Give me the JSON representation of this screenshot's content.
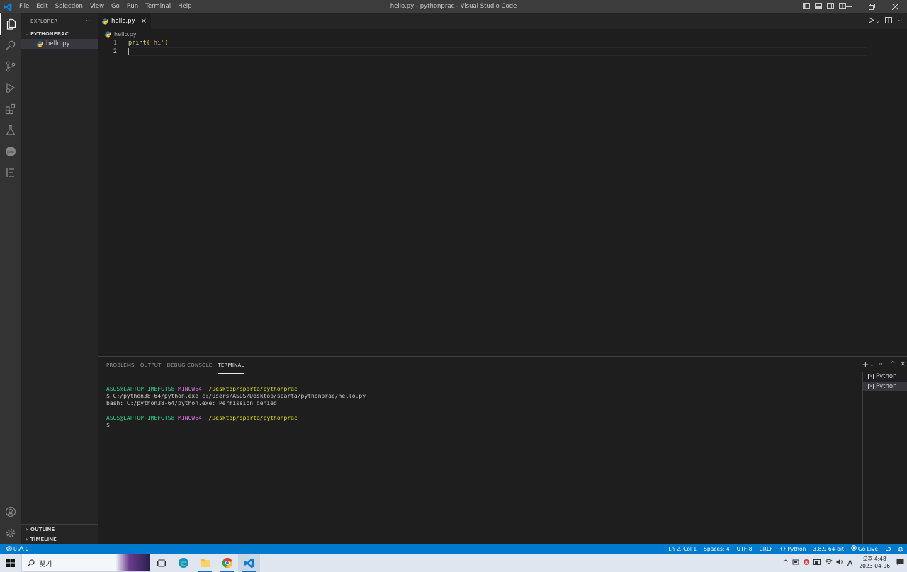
{
  "titlebar": {
    "title": "hello.py - pythonprac - Visual Studio Code",
    "menu": [
      "File",
      "Edit",
      "Selection",
      "View",
      "Go",
      "Run",
      "Terminal",
      "Help"
    ]
  },
  "sidebar": {
    "header": "EXPLORER",
    "more": "···",
    "folder": "PYTHONPRAC",
    "files": [
      "hello.py"
    ],
    "outline": "OUTLINE",
    "timeline": "TIMELINE"
  },
  "editor": {
    "tab_label": "hello.py",
    "breadcrumb": "hello.py",
    "lines": [
      {
        "number": "1",
        "fn": "print",
        "open": "(",
        "str": "'hi'",
        "close": ")"
      },
      {
        "number": "2"
      }
    ]
  },
  "panel": {
    "tabs": [
      "PROBLEMS",
      "OUTPUT",
      "DEBUG CONSOLE",
      "TERMINAL"
    ],
    "active_tab": "TERMINAL",
    "terminal": {
      "prompt_user": "ASUS@LAPTOP-1MEFGTS8",
      "prompt_shell": "MINGW64",
      "prompt_path": "~/Desktop/sparta/pythonprac",
      "command": "$ C:/python38-64/python.exe c:/Users/ASUS/Desktop/sparta/pythonprac/hello.py",
      "error": "bash: C:/python38-64/python.exe: Permission denied",
      "prompt2_user": "ASUS@LAPTOP-1MEFGTS8",
      "prompt2_shell": "MINGW64",
      "prompt2_path": "~/Desktop/sparta/pythonprac",
      "prompt_symbol": "$"
    },
    "terminals": [
      "Python",
      "Python"
    ]
  },
  "statusbar": {
    "errors": "0",
    "warnings": "0",
    "position": "Ln 2, Col 1",
    "spaces": "Spaces: 4",
    "encoding": "UTF-8",
    "eol": "CRLF",
    "language": "Python",
    "interpreter": "3.8.9 64-bit",
    "golive": "Go Live"
  },
  "taskbar": {
    "search_placeholder": "찾기",
    "clock_time": "오후 4:48",
    "clock_date": "2023-04-06",
    "ime": "A"
  },
  "colors": {
    "accent": "#007acc",
    "terminal_green": "#23d18b",
    "terminal_purple": "#d670d6",
    "terminal_yellow": "#e5e510"
  }
}
